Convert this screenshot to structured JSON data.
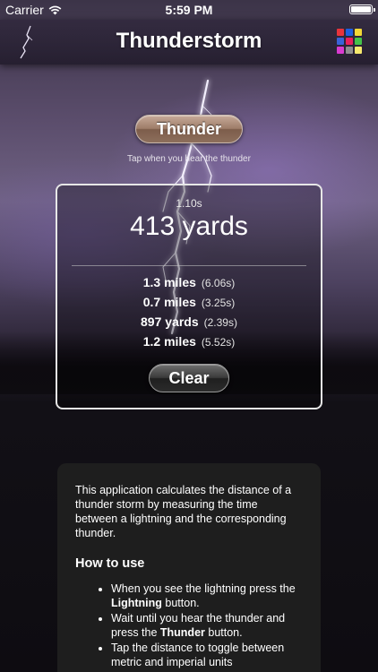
{
  "status_bar": {
    "carrier": "Carrier",
    "time": "5:59 PM"
  },
  "nav": {
    "title": "Thunderstorm",
    "apps_icon_colors": [
      "#e8343b",
      "#1e5fe0",
      "#f3d836",
      "#3a63d8",
      "#e91f5c",
      "#44c24a",
      "#d93bd0",
      "#8f8f8f",
      "#f6e96d"
    ]
  },
  "thunder_button": {
    "label": "Thunder"
  },
  "tap_hint": "Tap when you hear the thunder",
  "result": {
    "elapsed": "1.10s",
    "distance": "413 yards",
    "history": [
      {
        "distance": "1.3 miles",
        "time": "(6.06s)"
      },
      {
        "distance": "0.7 miles",
        "time": "(3.25s)"
      },
      {
        "distance": "897 yards",
        "time": "(2.39s)"
      },
      {
        "distance": "1.2 miles",
        "time": "(5.52s)"
      }
    ],
    "clear_label": "Clear"
  },
  "info": {
    "description": "This application calculates the distance of a thunder storm by measuring the time between a lightning and the corresponding thunder.",
    "howto_heading": "How to use",
    "steps": [
      {
        "before": "When you see the lightning press the ",
        "bold": "Lightning",
        "after": " button."
      },
      {
        "before": "Wait until you hear the thunder and press the ",
        "bold": "Thunder",
        "after": " button."
      },
      {
        "before": "Tap the distance to toggle between metric and imperial units",
        "bold": "",
        "after": ""
      }
    ]
  },
  "colors": {
    "accent_button": "#9e7d69",
    "panel_background": "#1e1e1e"
  }
}
